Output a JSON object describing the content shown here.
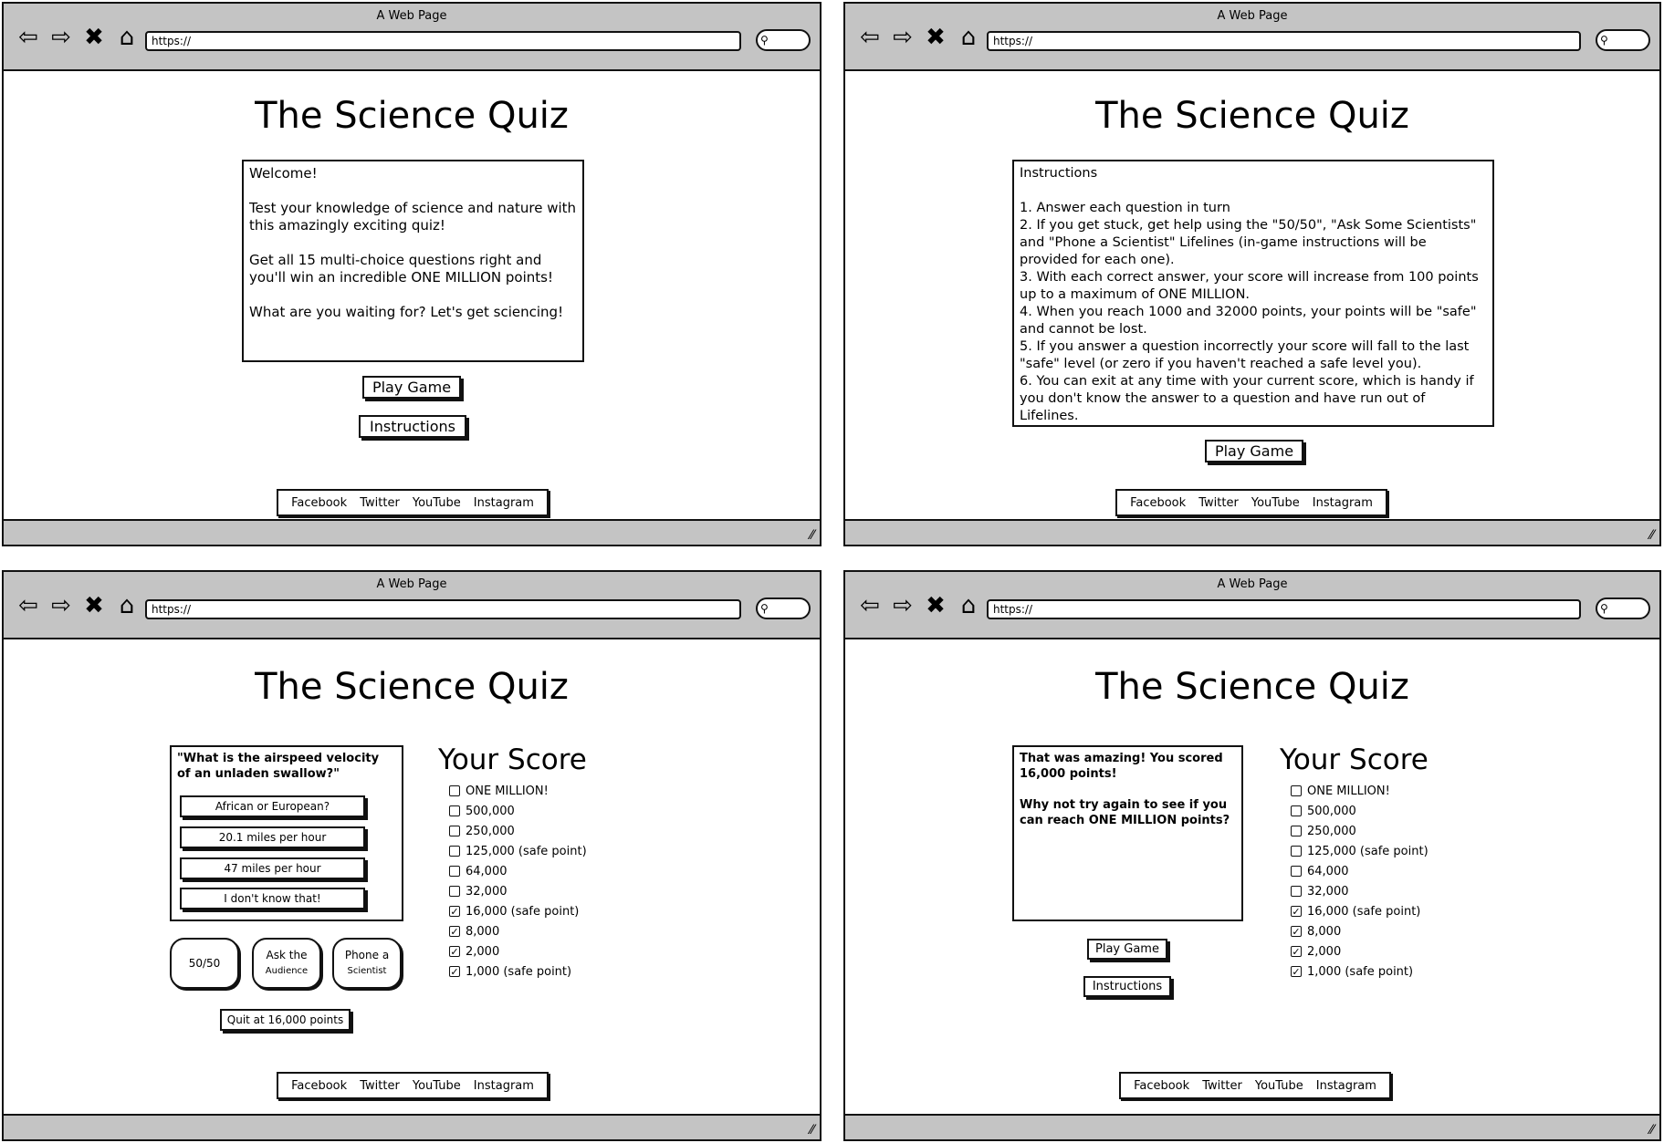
{
  "browser": {
    "title": "A Web Page",
    "url": "https://",
    "nav_glyphs": {
      "back": "⇦",
      "forward": "⇨",
      "close": "✖",
      "home": "⌂"
    },
    "search_glyph": "⚲",
    "resize_glyph": "⁄⁄"
  },
  "page_title": "The Science Quiz",
  "footer_links": [
    "Facebook",
    "Twitter",
    "YouTube",
    "Instagram"
  ],
  "welcome": {
    "heading": "Welcome!",
    "p1": "Test your knowledge of science and nature with this amazingly exciting quiz!",
    "p2": "Get all 15 multi-choice questions right and you'll win an incredible ONE MILLION points!",
    "p3": "What are you waiting for? Let's get sciencing!",
    "play_label": "Play Game",
    "instructions_label": "Instructions"
  },
  "instructions": {
    "heading": "Instructions",
    "items": [
      "1. Answer each question in turn",
      "2. If you get stuck, get help using the \"50/50\", \"Ask Some Scientists\" and \"Phone a Scientist\" Lifelines (in-game instructions will be provided for each one).",
      "3. With each correct answer, your score will increase from 100 points up to a maximum of ONE MILLION.",
      "4. When you reach 1000 and 32000 points, your points will be \"safe\" and cannot be lost.",
      "5. If you answer a question incorrectly your score will fall to the last \"safe\" level (or zero if you haven't reached a safe level you).",
      "6. You can exit at any time with your current score, which is handy if you don't know the answer to a question and have run out of Lifelines."
    ],
    "play_label": "Play Game"
  },
  "game": {
    "question": "\"What is the airspeed velocity of an unladen swallow?\"",
    "answers": [
      "African or European?",
      "20.1 miles per hour",
      "47 miles per hour",
      "I don't know that!"
    ],
    "lifelines": {
      "fifty": "50/50",
      "audience_top": "Ask the",
      "audience_bottom": "Audience",
      "phone_top": "Phone a",
      "phone_bottom": "Scientist"
    },
    "quit_label": "Quit at 16,000 points"
  },
  "score": {
    "title": "Your Score",
    "levels": [
      {
        "label": "ONE MILLION!",
        "checked": false
      },
      {
        "label": "500,000",
        "checked": false
      },
      {
        "label": "250,000",
        "checked": false
      },
      {
        "label": "125,000 (safe point)",
        "checked": false
      },
      {
        "label": "64,000",
        "checked": false
      },
      {
        "label": "32,000",
        "checked": false
      },
      {
        "label": "16,000 (safe point)",
        "checked": true
      },
      {
        "label": "8,000",
        "checked": true
      },
      {
        "label": "2,000",
        "checked": true
      },
      {
        "label": "1,000 (safe point)",
        "checked": true
      }
    ]
  },
  "result": {
    "line1": "That was amazing! You scored 16,000 points!",
    "line2": "Why not try again to see if you can reach ONE MILLION points?",
    "play_label": "Play Game",
    "instructions_label": "Instructions"
  }
}
